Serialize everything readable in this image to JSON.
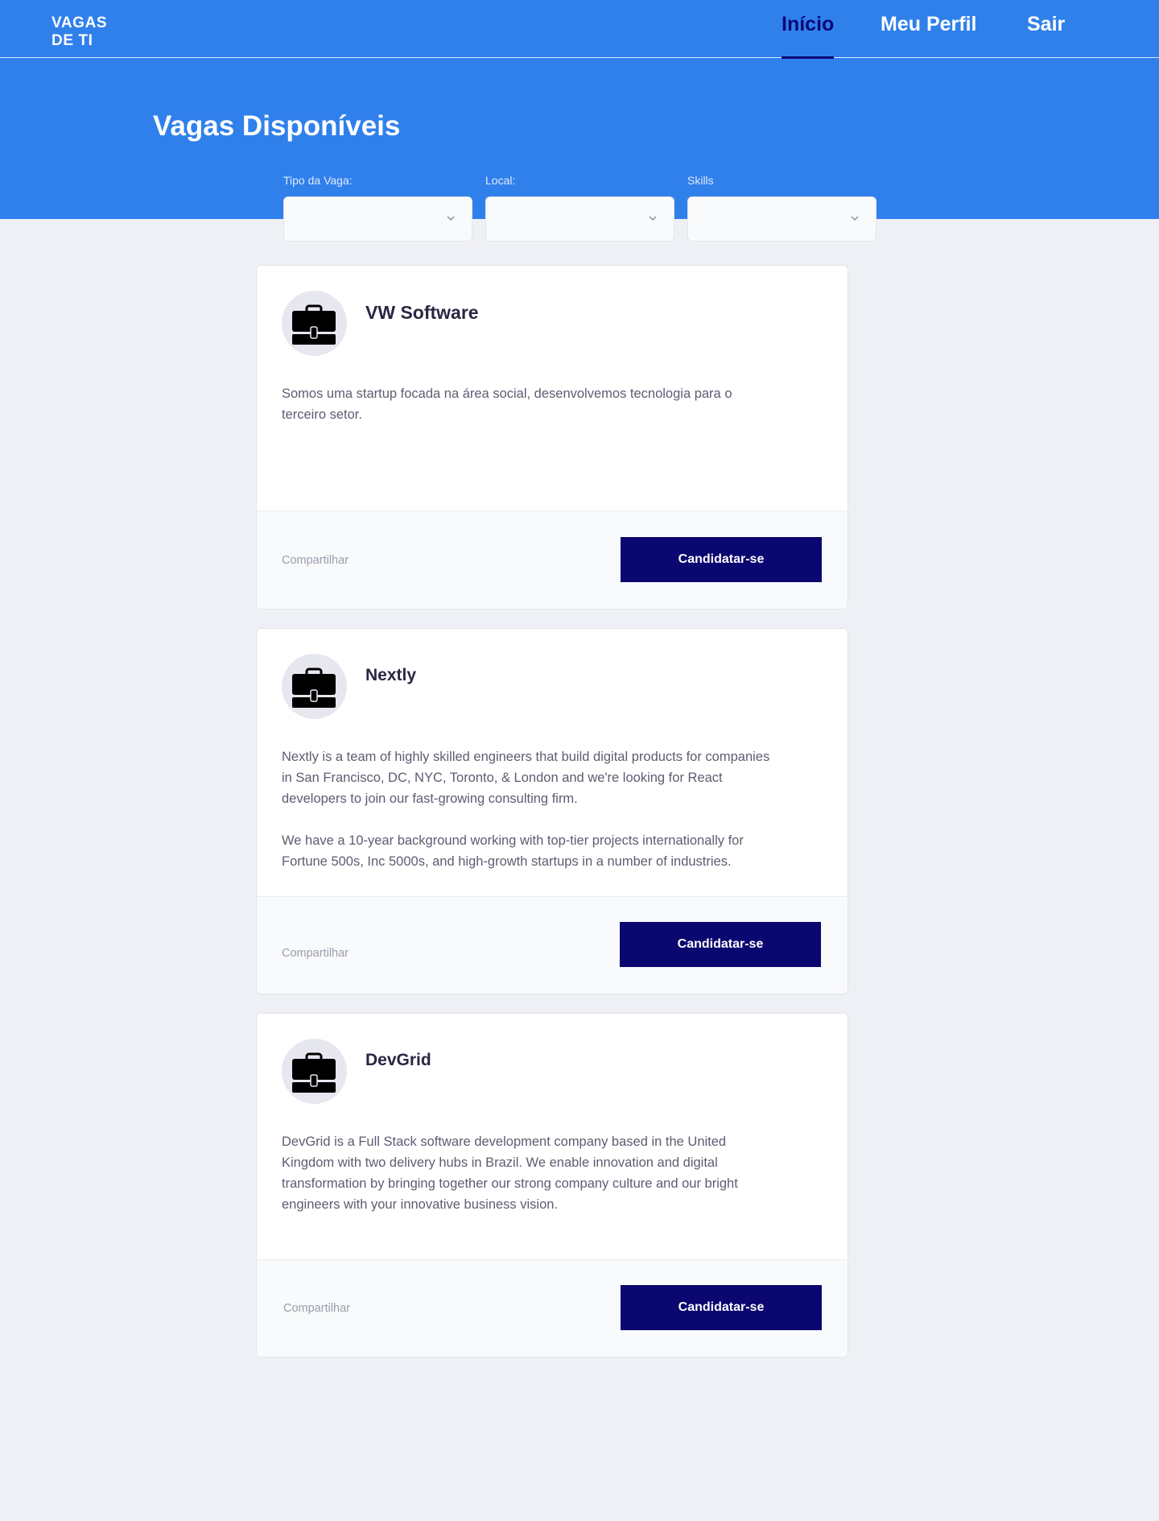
{
  "brand": {
    "line1": "VAGAS",
    "line2": "DE TI"
  },
  "nav": {
    "home": "Início",
    "profile": "Meu Perfil",
    "logout": "Sair"
  },
  "page": {
    "title": "Vagas Disponíveis"
  },
  "filters": {
    "type_label": "Tipo da Vaga:",
    "location_label": "Local:",
    "skills_label": "Skills"
  },
  "colors": {
    "primary": "#3080ec",
    "button": "#0b0770",
    "background": "#eff0f5"
  },
  "jobs": [
    {
      "company": "VW Software",
      "description": [
        "Somos uma startup focada na área social, desenvolvemos tecnologia para o terceiro setor."
      ],
      "share_label": "Compartilhar",
      "apply_label": "Candidatar-se",
      "icon": "briefcase-icon"
    },
    {
      "company": "Nextly",
      "description": [
        "Nextly is a team of highly skilled engineers that build digital products for companies in San Francisco, DC, NYC, Toronto, & London and we're looking for React developers to join our fast-growing consulting firm.",
        "We have a 10-year background working with top-tier projects internationally for Fortune 500s, Inc 5000s, and high-growth startups in a number of industries."
      ],
      "share_label": "Compartilhar",
      "apply_label": "Candidatar-se",
      "icon": "briefcase-icon"
    },
    {
      "company": "DevGrid",
      "description": [
        "DevGrid is a Full Stack software development company based in the United Kingdom with two delivery hubs in Brazil. We enable innovation and digital transformation by bringing together our strong company culture and our bright engineers with your innovative business vision."
      ],
      "share_label": "Compartilhar",
      "apply_label": "Candidatar-se",
      "icon": "briefcase-icon"
    }
  ]
}
